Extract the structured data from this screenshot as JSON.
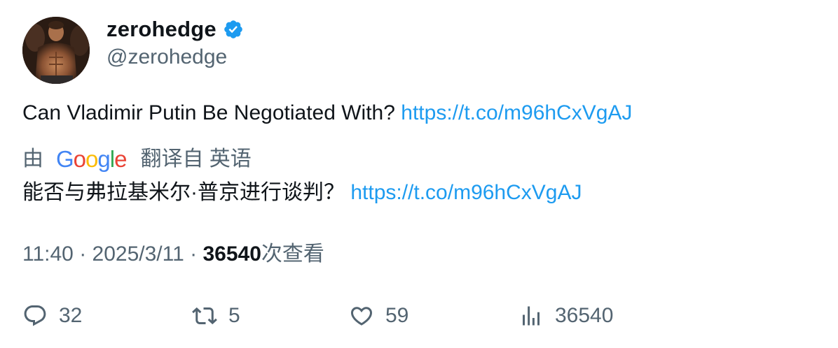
{
  "author": {
    "display_name": "zerohedge",
    "handle": "@zerohedge",
    "verified": true,
    "verified_color": "#1d9bf0"
  },
  "tweet": {
    "text": "Can Vladimir Putin Be Negotiated With?",
    "link": "https://t.co/m96hCxVgAJ"
  },
  "translation": {
    "prefix": "由",
    "provider": "Google",
    "suffix": "翻译自 英语",
    "text": "能否与弗拉基米尔·普京进行谈判？",
    "link": "https://t.co/m96hCxVgAJ"
  },
  "meta": {
    "time": "11:40",
    "separator": "·",
    "date": "2025/3/11",
    "views": "36540",
    "views_label": "次查看"
  },
  "actions": {
    "replies": "32",
    "retweets": "5",
    "likes": "59",
    "views": "36540"
  },
  "colors": {
    "text": "#0f1419",
    "secondary": "#536471",
    "link": "#1d9bf0"
  },
  "icons": [
    "verified-badge-icon",
    "reply-icon",
    "retweet-icon",
    "like-icon",
    "analytics-icon"
  ]
}
